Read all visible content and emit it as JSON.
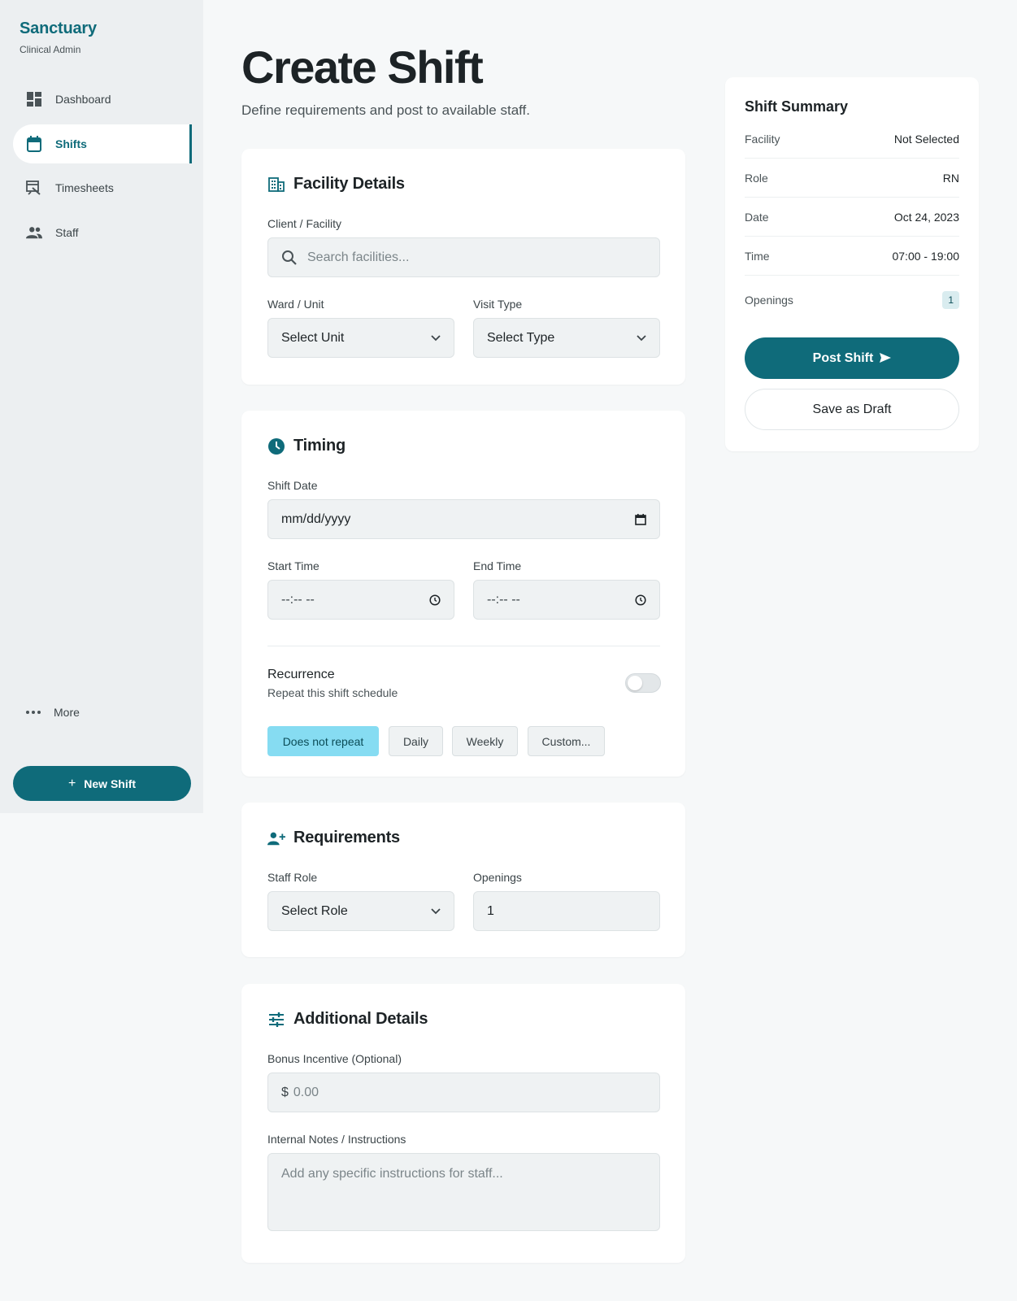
{
  "brand": {
    "name": "Sanctuary",
    "subtitle": "Clinical Admin"
  },
  "sidebar": {
    "items": [
      {
        "label": "Dashboard",
        "icon": "dashboard-icon",
        "active": false
      },
      {
        "label": "Shifts",
        "icon": "calendar-icon",
        "active": true
      },
      {
        "label": "Timesheets",
        "icon": "timesheet-icon",
        "active": false
      },
      {
        "label": "Staff",
        "icon": "people-icon",
        "active": false
      }
    ],
    "more_label": "More",
    "new_shift_label": "New Shift"
  },
  "page": {
    "title": "Create Shift",
    "subtitle": "Define requirements and post to available staff."
  },
  "facility": {
    "title": "Facility Details",
    "client_label": "Client / Facility",
    "search_placeholder": "Search facilities...",
    "ward_label": "Ward / Unit",
    "ward_value": "Select Unit",
    "visit_label": "Visit Type",
    "visit_value": "Select Type"
  },
  "timing": {
    "title": "Timing",
    "date_label": "Shift Date",
    "date_value": "mm/dd/yyyy",
    "start_label": "Start Time",
    "start_value": "--:-- --",
    "end_label": "End Time",
    "end_value": "--:-- --",
    "recurrence_title": "Recurrence",
    "recurrence_sub": "Repeat this shift schedule",
    "recurrence_enabled": false,
    "options": [
      "Does not repeat",
      "Daily",
      "Weekly",
      "Custom..."
    ],
    "selected_option": "Does not repeat"
  },
  "requirements": {
    "title": "Requirements",
    "role_label": "Staff Role",
    "role_value": "Select Role",
    "openings_label": "Openings",
    "openings_value": "1"
  },
  "additional": {
    "title": "Additional Details",
    "bonus_label": "Bonus Incentive (Optional)",
    "bonus_prefix": "$",
    "bonus_placeholder": "0.00",
    "notes_label": "Internal Notes / Instructions",
    "notes_placeholder": "Add any specific instructions for staff..."
  },
  "summary": {
    "title": "Shift Summary",
    "rows": [
      {
        "key": "Facility",
        "value": "Not Selected"
      },
      {
        "key": "Role",
        "value": "RN"
      },
      {
        "key": "Date",
        "value": "Oct 24, 2023"
      },
      {
        "key": "Time",
        "value": "07:00 - 19:00"
      },
      {
        "key": "Openings",
        "value": "1"
      }
    ],
    "post_label": "Post Shift",
    "draft_label": "Save as Draft"
  },
  "colors": {
    "brand": "#0f6b7a",
    "chip_active": "#86dcf2",
    "background": "#f6f8f9",
    "sidebar": "#eceff1"
  }
}
